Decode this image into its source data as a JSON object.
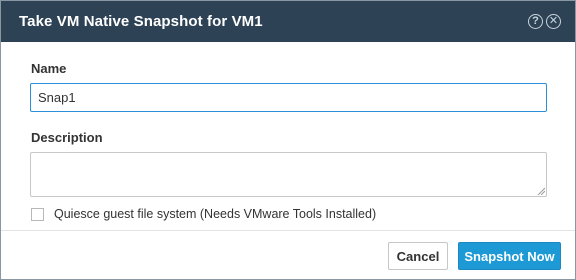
{
  "dialog": {
    "title": "Take VM Native Snapshot for VM1",
    "help_icon": "help-circle-icon",
    "close_icon": "close-circle-icon",
    "help_glyph": "?",
    "close_glyph": "✕"
  },
  "form": {
    "name_label": "Name",
    "name_value": "Snap1",
    "description_label": "Description",
    "description_value": "",
    "quiesce_label": "Quiesce guest file system (Needs VMware Tools Installed)",
    "quiesce_checked": false
  },
  "footer": {
    "cancel_label": "Cancel",
    "primary_label": "Snapshot Now"
  },
  "colors": {
    "titlebar": "#2d4255",
    "accent": "#1d9ad6",
    "focus_border": "#2b90d9"
  }
}
